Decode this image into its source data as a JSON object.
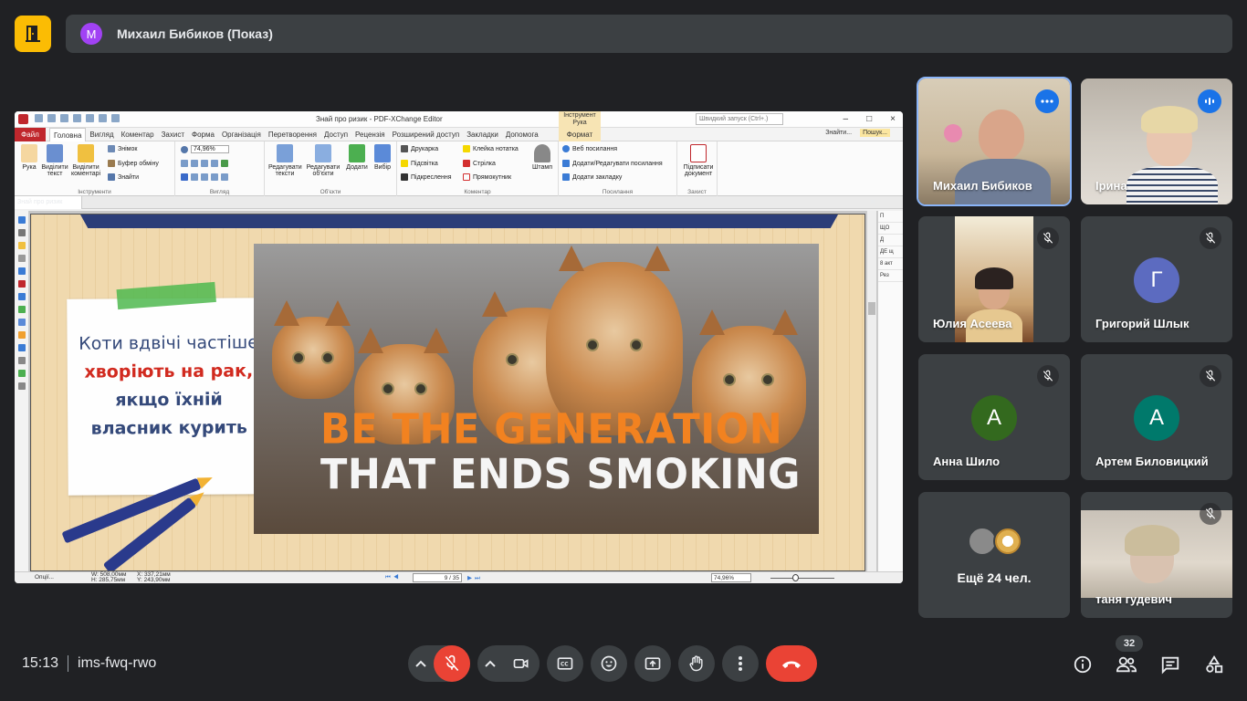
{
  "banner": {
    "presenter_initial": "М",
    "presenter_text": "Михаил Бибиков (Показ)"
  },
  "editor": {
    "window_title": "Знай про ризик - PDF-XChange Editor",
    "tool_context_tab": "Інструмент Рука",
    "quick_search": "Швидкий запуск (Ctrl+.)",
    "file_tab": "Файл",
    "tabs": [
      "Головна",
      "Вигляд",
      "Коментар",
      "Захист",
      "Форма",
      "Організація",
      "Перетворення",
      "Доступ",
      "Рецензія",
      "Розширений доступ",
      "Закладки",
      "Допомога"
    ],
    "format_tab": "Формат",
    "find_btn": "Знайти...",
    "search_btn": "Пошук...",
    "ribbon": {
      "hand": "Рука",
      "select_text": "Виділити текст",
      "select_comments": "Виділити коментарі",
      "snapshot": "Знімок",
      "clipboard": "Буфер обміну",
      "find": "Знайти",
      "group_tools": "Інструменти",
      "zoom_value": "74,96%",
      "group_view": "Вигляд",
      "edit_text": "Редагувати тексти",
      "edit_objects": "Редагувати об'єкти",
      "add": "Додати",
      "select": "Вибір",
      "group_objects": "Об'єкти",
      "typewriter": "Друкарка",
      "highlight": "Підсвітка",
      "underline": "Підкреслення",
      "sticky": "Клейка нотатка",
      "arrow": "Стрілка",
      "rectangle": "Прямокутник",
      "stamp": "Штамп",
      "group_comment": "Коментар",
      "web_links": "Веб посилання",
      "add_edit_links": "Додати/Редагувати посилання",
      "add_bookmark": "Додати закладку",
      "group_links": "Посилання",
      "sign": "Підписати документ",
      "group_protect": "Захист"
    },
    "doc_tab": "Знай про ризик",
    "right_panel": [
      "П",
      "ЩО",
      "Д",
      "ДЕ щ",
      "8 акт",
      "Рез"
    ],
    "status": {
      "options": "Опції...",
      "w": "W: 508,00мм",
      "h": "H: 285,75мм",
      "x": "X: 337,21мм",
      "y": "Y: 243,90мм",
      "page": "9",
      "page_total": "/ 35",
      "zoom": "74,96%"
    }
  },
  "slide": {
    "note_line1": "Коти вдвічі частіше",
    "note_line2": "хворіють на рак,",
    "note_line3": "якщо їхній",
    "note_line4": "власник курить",
    "slogan1": "BE THE GENERATION",
    "slogan2": "THAT ENDS SMOKING"
  },
  "participants": [
    {
      "name": "Михаил Бибиков",
      "state": "video"
    },
    {
      "name": "Ірина",
      "state": "video"
    },
    {
      "name": "Юлия Асеева",
      "state": "video"
    },
    {
      "name": "Григорий Шлык",
      "initial": "Г",
      "color": "#5c6bc0"
    },
    {
      "name": "Анна Шило",
      "initial": "А",
      "color": "#33691e"
    },
    {
      "name": "Артем Биловицкий",
      "initial": "А",
      "color": "#00796b"
    },
    {
      "name": "Ещё 24 чел."
    },
    {
      "name": "таня гудевич",
      "state": "video"
    }
  ],
  "bottom": {
    "time": "15:13",
    "meeting_code": "ims-fwq-rwo",
    "participant_count": "32"
  },
  "colors": {
    "meet_bg": "#202124",
    "tile_bg": "#3c4043",
    "present_accent": "#fbbc04",
    "danger": "#ea4335",
    "active_outline": "#8ab4f8"
  }
}
